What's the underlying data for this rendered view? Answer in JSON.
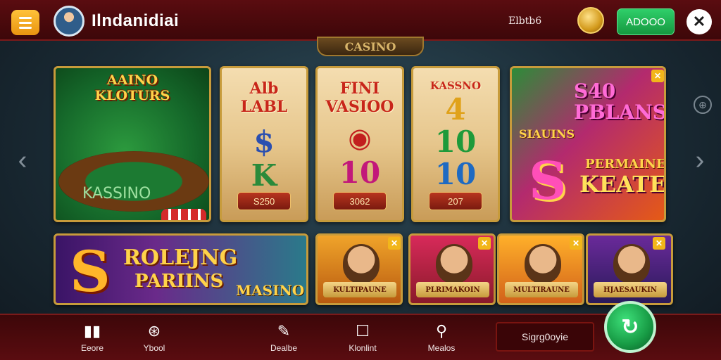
{
  "header": {
    "menu_icon": "hamburger-icon",
    "username": "Ilndanidiai",
    "balance_label": "Elbtb6",
    "coin_icon": "coin-icon",
    "add_button": "ADOOO",
    "close_symbol": "✕"
  },
  "sign": "CASINO",
  "carousel": {
    "left_arrow": "‹",
    "right_arrow": "›",
    "info": "⊕"
  },
  "cards": {
    "roulette": {
      "title_line1": "AAINO",
      "title_line2": "KLOTURS",
      "felt_text": "KASSINO"
    },
    "reel1": {
      "title_line1": "Alb",
      "title_line2": "LABL",
      "symbol1": "$",
      "symbol2": "K",
      "price": "S250"
    },
    "reel2": {
      "title_line1": "FINI",
      "title_line2": "VASIOO",
      "symbol1": "10",
      "price": "3062"
    },
    "reel3": {
      "title": "KASSNO",
      "symbol1": "4",
      "symbol2": "10",
      "symbol3": "10",
      "price": "207"
    },
    "promo": {
      "title_line1": "S40",
      "title_line2": "PBLANS",
      "sub": "SIAUINS",
      "big_s": "S",
      "title3": "PERMAINEIN",
      "title4": "KEATED"
    },
    "banner": {
      "big_s": "S",
      "line1": "ROLEJNG",
      "line2": "PARIINS",
      "line3": "MASINO"
    },
    "small1": {
      "label": "KULTIPAUNE"
    },
    "small2": {
      "label": "PLRIMAKOIN"
    },
    "small3": {
      "label": "MULTIRAUNE"
    },
    "small4": {
      "label": "HJAESAUKIN"
    }
  },
  "nav": {
    "item1": {
      "icon": "▮▮",
      "label": "Eeore"
    },
    "item2": {
      "icon": "⊛",
      "label": "Ybool"
    },
    "item3": {
      "icon": "✎",
      "label": "Dealbe"
    },
    "item4": {
      "icon": "☐",
      "label": "Klonlint"
    },
    "item5": {
      "icon": "⚲",
      "label": "Mealos"
    },
    "promo": "Sigrg0oyie",
    "play_symbol": "↻"
  }
}
